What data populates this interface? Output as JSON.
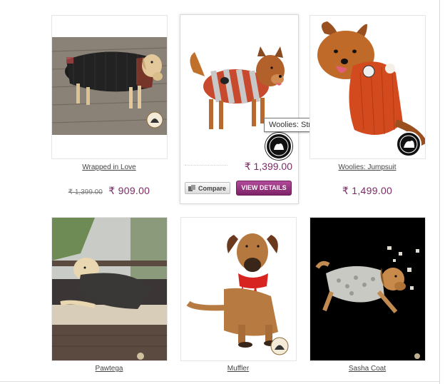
{
  "products": [
    {
      "name": "Wrapped in Love",
      "old_price": "₹ 1,399.00",
      "price": "₹ 909.00"
    },
    {
      "name": "Woolies: Striped Sweater",
      "price": "₹ 1,399.00"
    },
    {
      "name": "Woolies: Jumpsuit",
      "price": "₹ 1,499.00"
    },
    {
      "name": "Pawtega"
    },
    {
      "name": "Muffler"
    },
    {
      "name": "Sasha Coat"
    }
  ],
  "hover": {
    "compare_label": "Compare",
    "view_label": "VIEW DETAILS"
  },
  "tooltip": "Woolies: Striped Sweater",
  "colors": {
    "price": "#7b2a66",
    "button": "#9b3585"
  }
}
